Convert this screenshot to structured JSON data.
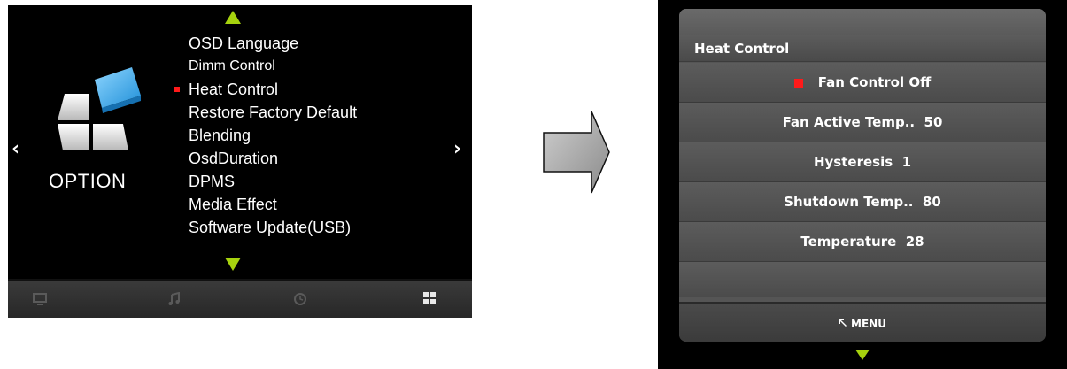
{
  "left_panel": {
    "category_label": "OPTION",
    "menu_items": [
      {
        "label": "OSD Language",
        "selected": false,
        "small": false
      },
      {
        "label": "Dimm Control",
        "selected": false,
        "small": true
      },
      {
        "label": "Heat Control",
        "selected": true,
        "small": false
      },
      {
        "label": "Restore Factory Default",
        "selected": false,
        "small": false
      },
      {
        "label": "Blending",
        "selected": false,
        "small": false
      },
      {
        "label": "OsdDuration",
        "selected": false,
        "small": false
      },
      {
        "label": "DPMS",
        "selected": false,
        "small": false
      },
      {
        "label": "Media Effect",
        "selected": false,
        "small": false
      },
      {
        "label": "Software Update(USB)",
        "selected": false,
        "small": false
      }
    ],
    "nav_prev_glyph": "‹",
    "nav_next_glyph": "›",
    "bottom_tabs": [
      {
        "icon": "monitor-icon",
        "glyph": "🖵",
        "active": false
      },
      {
        "icon": "music-icon",
        "glyph": "♫",
        "active": false
      },
      {
        "icon": "clock-icon",
        "glyph": "⊙",
        "active": false
      },
      {
        "icon": "grid-icon",
        "glyph": "▦",
        "active": true
      }
    ],
    "accent_color": "#a6d20e",
    "selection_color": "#ff1a1a"
  },
  "right_panel": {
    "title": "Heat Control",
    "rows": [
      {
        "label": "Fan Control Off",
        "selected": true
      },
      {
        "label": "Fan Active Temp..  50",
        "selected": false
      },
      {
        "label": "Hysteresis  1",
        "selected": false
      },
      {
        "label": "Shutdown Temp..  80",
        "selected": false
      },
      {
        "label": "Temperature  28",
        "selected": false
      }
    ],
    "footer_label": "MENU",
    "footer_icon": "back-arrow-icon"
  }
}
